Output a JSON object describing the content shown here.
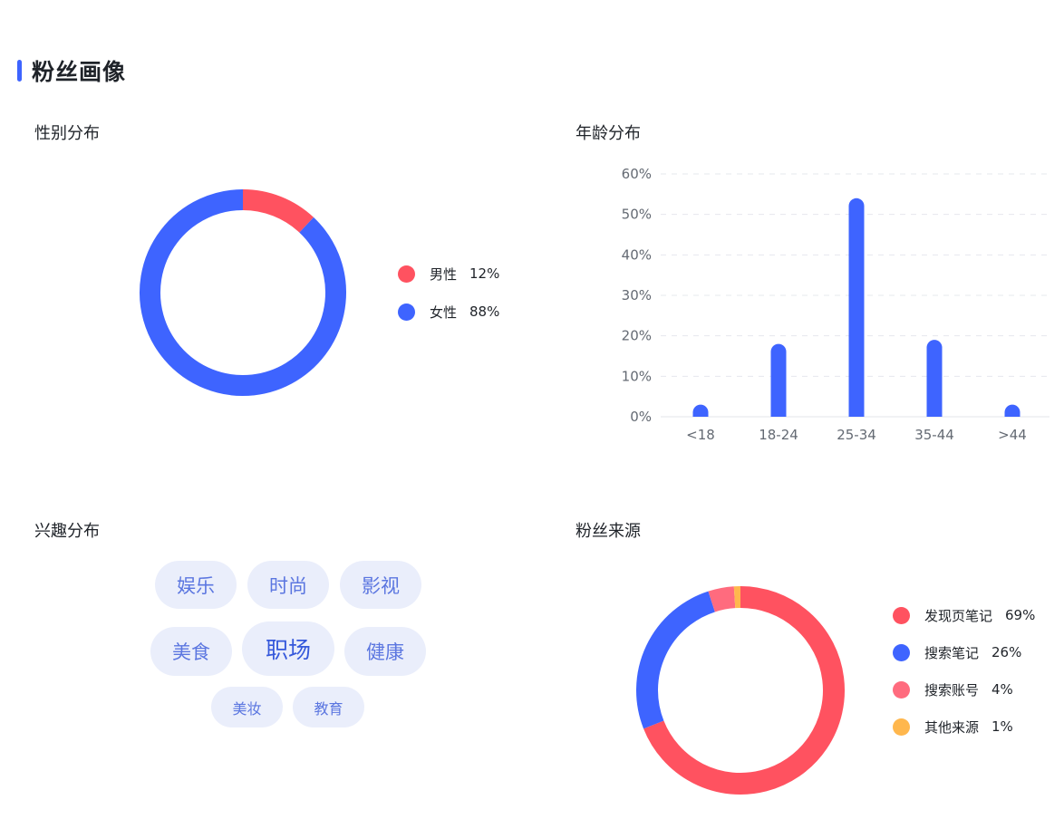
{
  "section": {
    "title": "粉丝画像",
    "accent": "#3e64ff"
  },
  "gender": {
    "title": "性别分布",
    "chart_data": {
      "type": "pie",
      "variant": "donut",
      "legend_position": "right",
      "series": [
        {
          "name": "男性",
          "label": "12%",
          "value": 12,
          "color": "#ff5260"
        },
        {
          "name": "女性",
          "label": "88%",
          "value": 88,
          "color": "#3e64ff"
        }
      ]
    }
  },
  "age": {
    "title": "年龄分布",
    "chart_data": {
      "type": "bar",
      "categories": [
        "<18",
        "18-24",
        "25-34",
        "35-44",
        ">44"
      ],
      "values": [
        3,
        18,
        54,
        19,
        3
      ],
      "ylim": [
        0,
        60
      ],
      "yticks": [
        0,
        10,
        20,
        30,
        40,
        50,
        60
      ],
      "ytick_labels": [
        "0%",
        "10%",
        "20%",
        "30%",
        "40%",
        "50%",
        "60%"
      ],
      "grid": true,
      "color": "#3e64ff"
    }
  },
  "interest": {
    "title": "兴趣分布",
    "tags": [
      "娱乐",
      "时尚",
      "影视",
      "美食",
      "职场",
      "健康",
      "美妆",
      "教育"
    ]
  },
  "source": {
    "title": "粉丝来源",
    "chart_data": {
      "type": "pie",
      "variant": "donut",
      "legend_position": "right",
      "series": [
        {
          "name": "发现页笔记",
          "label": "69%",
          "value": 69,
          "color": "#ff5260"
        },
        {
          "name": "搜索笔记",
          "label": "26%",
          "value": 26,
          "color": "#3e64ff"
        },
        {
          "name": "搜索账号",
          "label": "4%",
          "value": 4,
          "color": "#ff6b7e"
        },
        {
          "name": "其他来源",
          "label": "1%",
          "value": 1,
          "color": "#ffb74d"
        }
      ]
    }
  }
}
